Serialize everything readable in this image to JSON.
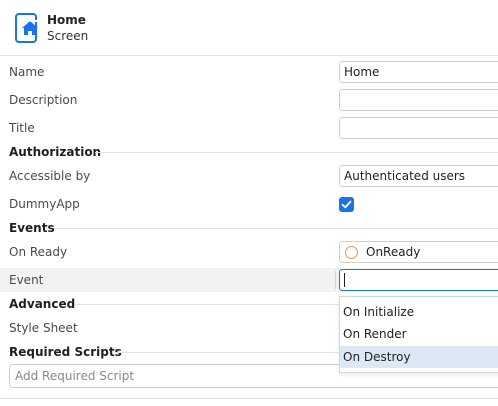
{
  "header": {
    "title": "Home",
    "subtitle": "Screen",
    "icon": "home-screen-icon"
  },
  "properties": {
    "name_label": "Name",
    "name_value": "Home",
    "description_label": "Description",
    "description_value": "",
    "title_label": "Title",
    "title_value": ""
  },
  "authorization": {
    "section": "Authorization",
    "accessible_label": "Accessible by",
    "accessible_value": "Authenticated users",
    "dummyapp_label": "DummyApp",
    "dummyapp_checked": true
  },
  "events": {
    "section": "Events",
    "onready_label": "On Ready",
    "onready_value": "OnReady",
    "event_label": "Event",
    "event_value": "",
    "options": [
      "On Initialize",
      "On Render",
      "On Destroy"
    ],
    "highlighted_option": "On Destroy"
  },
  "advanced": {
    "section": "Advanced",
    "stylesheet_label": "Style Sheet"
  },
  "required_scripts": {
    "section": "Required Scripts",
    "placeholder": "Add Required Script"
  },
  "colors": {
    "accent": "#1a73e8",
    "dropdown_highlight": "#dde8f6"
  }
}
